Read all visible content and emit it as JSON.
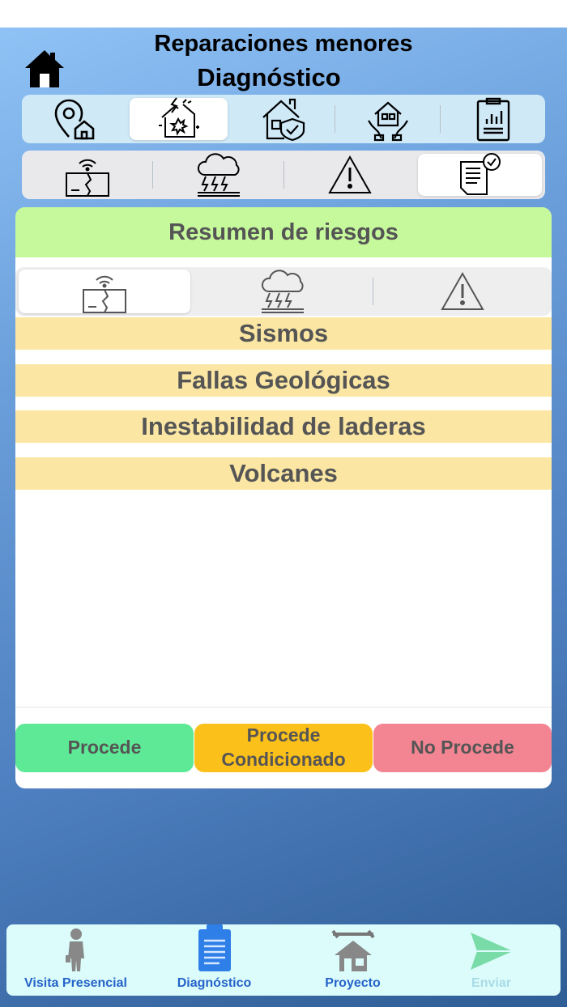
{
  "header": {
    "title_line1": "Reparaciones menores",
    "title_line2": "Diagnóstico"
  },
  "top_tabs": [
    {
      "icon": "location-house-icon",
      "selected": false
    },
    {
      "icon": "house-damage-icon",
      "selected": true
    },
    {
      "icon": "house-shield-icon",
      "selected": false
    },
    {
      "icon": "hands-house-icon",
      "selected": false
    },
    {
      "icon": "report-clipboard-icon",
      "selected": false
    }
  ],
  "risk_tabs": [
    {
      "icon": "earthquake-crack-icon",
      "selected": false
    },
    {
      "icon": "storm-cloud-icon",
      "selected": false
    },
    {
      "icon": "warning-triangle-icon",
      "selected": false
    },
    {
      "icon": "checklist-document-icon",
      "selected": true
    }
  ],
  "summary": {
    "title": "Resumen de riesgos",
    "segments": [
      {
        "icon": "earthquake-crack-icon",
        "selected": true
      },
      {
        "icon": "storm-cloud-icon",
        "selected": false
      },
      {
        "icon": "warning-triangle-icon",
        "selected": false
      }
    ],
    "risks": [
      "Sismos",
      "Fallas Geológicas",
      "Inestabilidad de laderas",
      "Volcanes"
    ]
  },
  "decisions": {
    "procede": "Procede",
    "condicionado_line1": "Procede",
    "condicionado_line2": "Condicionado",
    "no_procede": "No Procede",
    "colors": {
      "procede": "#5ee996",
      "condicionado": "#fcc01a",
      "no_procede": "#f38593"
    }
  },
  "bottom_nav": [
    {
      "label": "Visita Presencial",
      "icon": "person-icon"
    },
    {
      "label": "Diagnóstico",
      "icon": "clipboard-icon"
    },
    {
      "label": "Proyecto",
      "icon": "house-tools-icon"
    },
    {
      "label": "Enviar",
      "icon": "send-icon",
      "disabled": true
    }
  ]
}
